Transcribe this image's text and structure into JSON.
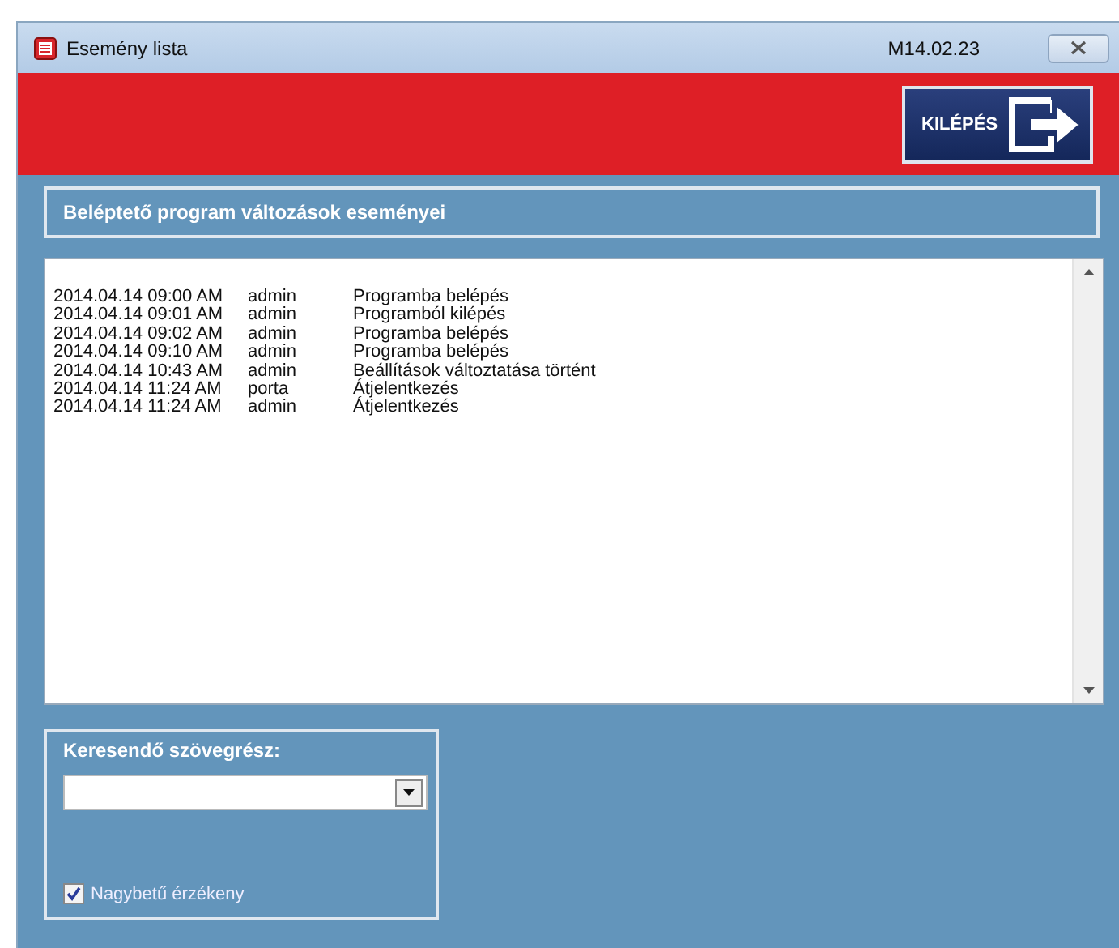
{
  "window": {
    "title": "Esemény lista",
    "version": "M14.02.23"
  },
  "exit_button": {
    "label": "KILÉPÉS"
  },
  "header": "Beléptető program változások eseményei",
  "events": [
    {
      "time": "2014.04.14 09:00 AM",
      "user": "admin",
      "event": "Programba belépés"
    },
    {
      "time": "2014.04.14 09:01 AM",
      "user": "admin",
      "event": "Programból kilépés"
    },
    {
      "time": "2014.04.14 09:02 AM",
      "user": "admin",
      "event": "Programba belépés"
    },
    {
      "time": "2014.04.14 09:10 AM",
      "user": "admin",
      "event": "Programba belépés"
    },
    {
      "time": "2014.04.14 10:43 AM",
      "user": "admin",
      "event": "Beállítások változtatása történt"
    },
    {
      "time": "2014.04.14 11:24 AM",
      "user": "porta",
      "event": "Átjelentkezés"
    },
    {
      "time": "2014.04.14 11:24 AM",
      "user": "admin",
      "event": "Átjelentkezés"
    }
  ],
  "search": {
    "label": "Keresendő szövegrész:",
    "case_sensitive": {
      "label": "Nagybetű érzékeny",
      "checked": true
    }
  }
}
